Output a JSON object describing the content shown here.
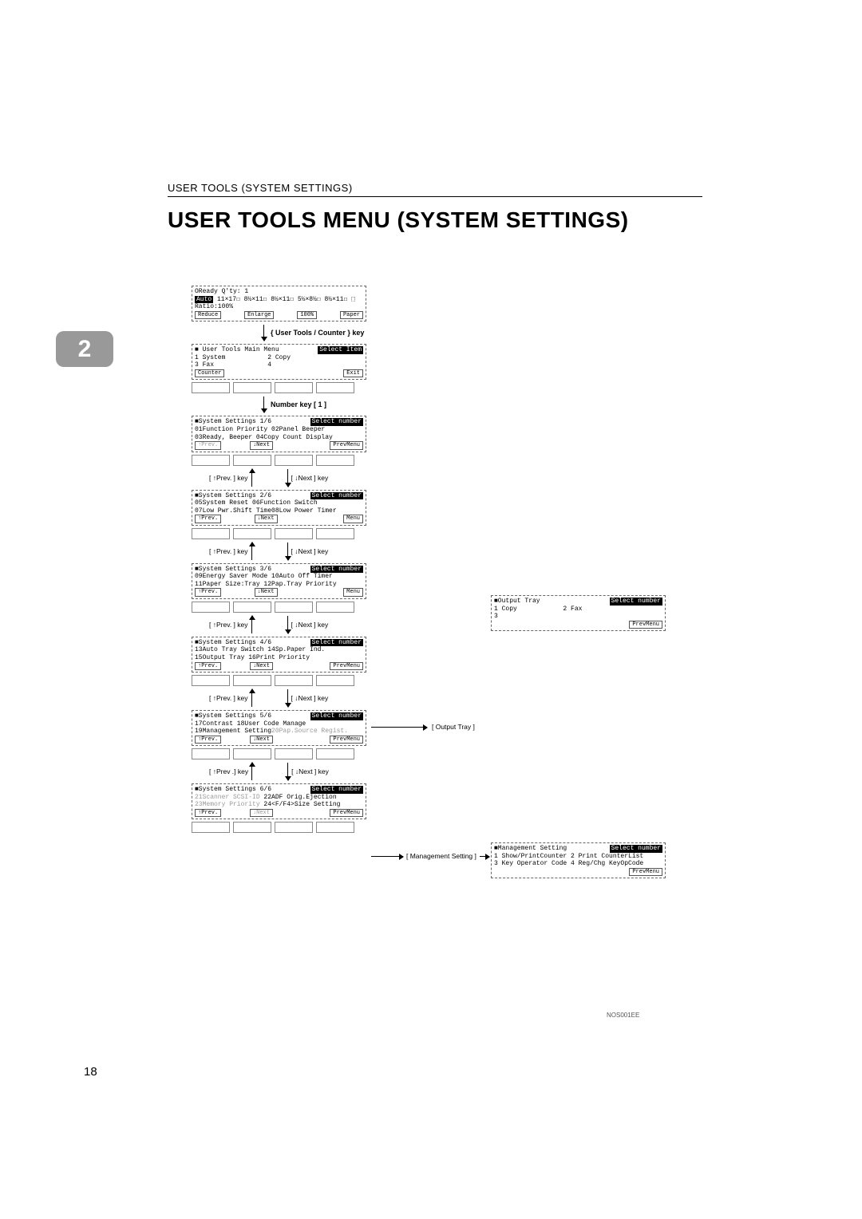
{
  "header": "USER TOOLS (SYSTEM SETTINGS)",
  "title": "USER TOOLS MENU (SYSTEM SETTINGS)",
  "chapter": "2",
  "screens": {
    "ready": {
      "l1": "OReady                        Q'ty:  1",
      "l2_pre": "Auto",
      "l2_post": "  11×17☐ 8½×11☐ 8½×11☐ 5½×8½☐ 8½×11☐ ⬚",
      "l3": "Ratio:100%",
      "b1": "Reduce",
      "b2": "Enlarge",
      "b3": "100%",
      "b4": "Paper"
    },
    "mainmenu": {
      "l1_pre": "■ User Tools Main Menu",
      "l1_post": "Select Item",
      "l2": "1 System           2 Copy",
      "l3": "3 Fax              4",
      "b1": "Counter",
      "b4": "Exit"
    },
    "s1": {
      "title": "■System Settings 1/6",
      "right": "Select number",
      "r1": "01Function Priority 02Panel Beeper",
      "r2": "03Ready, Beeper     04Copy Count Display",
      "nav_prev_gray": "↑Prev.",
      "nav_next": "↓Next",
      "nav_menu": "PrevMenu"
    },
    "s2": {
      "title": "■System Settings 2/6",
      "right": "Select number",
      "r1": "05System Reset      06Function Switch",
      "r2": "07Low Pwr.Shift Time08Low Power Timer",
      "nav_prev": "↑Prev.",
      "nav_next": "↓Next",
      "nav_menu": "Menu"
    },
    "s3": {
      "title": "■System Settings 3/6",
      "right": "Select number",
      "r1": "09Energy Saver Mode 10Auto Off Timer",
      "r2": "11Paper Size:Tray   12Pap.Tray Priority",
      "nav_prev": "↑Prev.",
      "nav_next": "↓Next",
      "nav_menu": "Menu"
    },
    "s4": {
      "title": "■System Settings 4/6",
      "right": "Select number",
      "r1": "13Auto Tray Switch  14Sp.Paper Ind.",
      "r2": "15Output Tray       16Print Priority",
      "nav_prev": "↑Prev.",
      "nav_next": "↓Next",
      "nav_menu": "PrevMenu"
    },
    "s5": {
      "title": "■System Settings 5/6",
      "right": "Select number",
      "r1": "17Contrast          18User Code Manage",
      "r2": "19Management Setting20Pap.Source Regist.",
      "nav_prev": "↑Prev.",
      "nav_next": "↓Next",
      "nav_menu": "PrevMenu"
    },
    "s6": {
      "title": "■System Settings 6/6",
      "right": "Select number",
      "r1_gray": "21Scanner SCSI-ID   ",
      "r1_b": "22ADF Orig.Ejection",
      "r2_gray": "23Memory Priority   ",
      "r2_b": "24<F/F4>Size Setting",
      "nav_prev": "↑Prev.",
      "nav_next_gray": "↓Next",
      "nav_menu": "PrevMenu"
    },
    "output_tray": {
      "title": "■Output Tray",
      "right": "Select number",
      "r1": "1 Copy            2 Fax",
      "r2": "3",
      "nav_menu": "PrevMenu"
    },
    "mgmt": {
      "title": "■Management Setting",
      "right": "Select number",
      "r1": "1 Show/PrintCounter 2 Print CounterList",
      "r2": "3 Key Operator Code 4 Reg/Chg KeyOpCode",
      "nav_menu": "PrevMenu"
    }
  },
  "keys": {
    "usertools": "{ User Tools / Counter } key",
    "number1": "Number key [ 1 ]",
    "prev": "[ ↑Prev. ] key",
    "next": "[ ↓Next ] key",
    "prevdot": "[ ↑Prev .] key"
  },
  "links": {
    "output": "[ Output Tray ]",
    "mgmt": "[ Management Setting ]"
  },
  "footer_code": "NOS001EE",
  "page_num": "18"
}
